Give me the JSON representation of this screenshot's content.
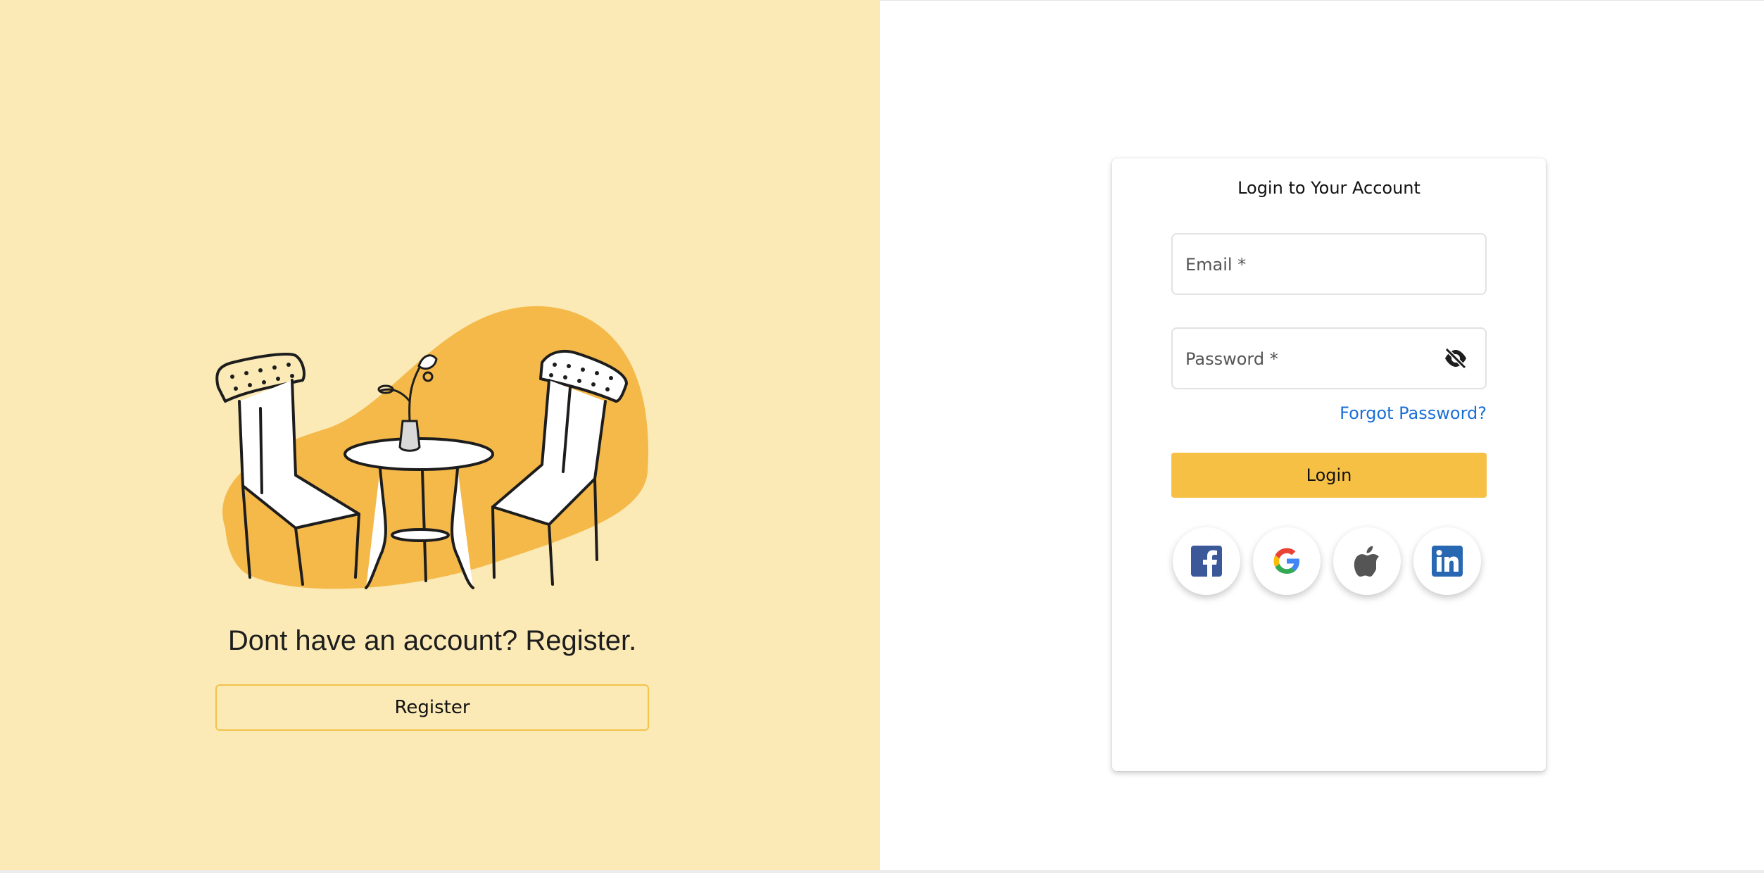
{
  "left_panel": {
    "prompt": "Dont have an account? Register.",
    "register_label": "Register"
  },
  "login_card": {
    "title": "Login to Your Account",
    "email_placeholder": "Email *",
    "password_placeholder": "Password *",
    "forgot_label": "Forgot Password?",
    "login_label": "Login",
    "social": [
      {
        "name": "facebook",
        "icon": "facebook-icon",
        "color": "#3b5998"
      },
      {
        "name": "google",
        "icon": "google-icon",
        "color": "#4285f4"
      },
      {
        "name": "apple",
        "icon": "apple-icon",
        "color": "#555555"
      },
      {
        "name": "linkedin",
        "icon": "linkedin-icon",
        "color": "#2867b2"
      }
    ]
  },
  "colors": {
    "left_background": "#fbeab6",
    "accent": "#f6c045",
    "blob": "#f5b94a",
    "link": "#1a6ed8"
  }
}
